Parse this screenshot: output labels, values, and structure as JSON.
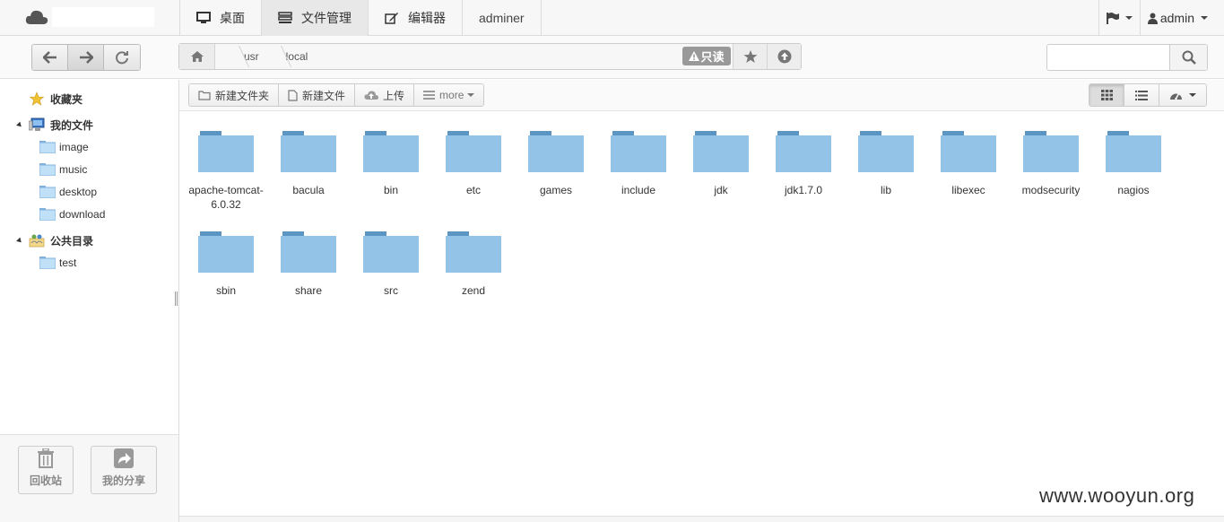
{
  "topnav": {
    "tabs": [
      {
        "label": "桌面",
        "icon": "monitor-icon"
      },
      {
        "label": "文件管理",
        "icon": "server-icon"
      },
      {
        "label": "编辑器",
        "icon": "edit-icon"
      },
      {
        "label": "adminer"
      }
    ],
    "active_tab": "文件管理",
    "user_label": "admin"
  },
  "address": {
    "crumbs": [
      "usr",
      "local"
    ],
    "readonly_label": "只读"
  },
  "search": {
    "placeholder": ""
  },
  "sidebar": {
    "favorites": "收藏夹",
    "my_files": "我的文件",
    "my_files_children": [
      "image",
      "music",
      "desktop",
      "download"
    ],
    "public": "公共目录",
    "public_children": [
      "test"
    ],
    "trash_label": "回收站",
    "share_label": "我的分享"
  },
  "toolbar": {
    "new_folder": "新建文件夹",
    "new_file": "新建文件",
    "upload": "上传",
    "more": "more"
  },
  "files": [
    "apache-tomcat-6.0.32",
    "bacula",
    "bin",
    "etc",
    "games",
    "include",
    "jdk",
    "jdk1.7.0",
    "lib",
    "libexec",
    "modsecurity",
    "nagios",
    "sbin",
    "share",
    "src",
    "zend"
  ],
  "colors": {
    "folder": "#93c3e6",
    "folder_tab": "#5b95c4",
    "accent_badge": "#999999"
  },
  "watermark": "www.wooyun.org"
}
